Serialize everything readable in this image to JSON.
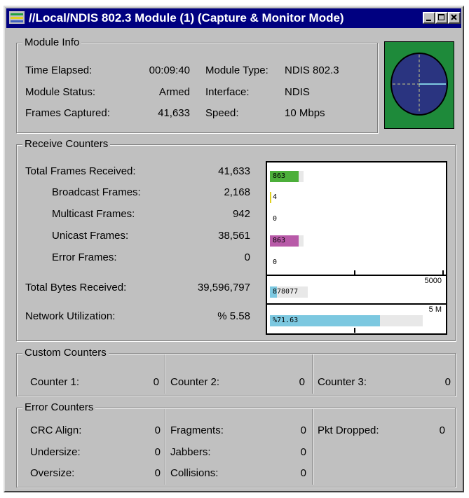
{
  "window": {
    "title": "//Local/NDIS 802.3 Module (1) (Capture & Monitor Mode)"
  },
  "module_info": {
    "label": "Module Info",
    "rows": [
      {
        "label": "Time Elapsed:",
        "value": "00:09:40",
        "label2": "Module Type:",
        "value2": "NDIS 802.3"
      },
      {
        "label": "Module Status:",
        "value": "Armed",
        "label2": "Interface:",
        "value2": "NDIS"
      },
      {
        "label": "Frames Captured:",
        "value": "41,633",
        "label2": "Speed:",
        "value2": "10 Mbps"
      }
    ]
  },
  "receive_counters": {
    "label": "Receive Counters",
    "rows": [
      {
        "label": "Total Frames Received:",
        "value": "41,633",
        "bar_label": "863",
        "bar_color": "#4caf3a",
        "fill_fraction": 0.86
      },
      {
        "label": "Broadcast Frames:",
        "value": "2,168",
        "bar_label": "4",
        "bar_color": "#e0d020",
        "fill_fraction": 0.04
      },
      {
        "label": "Multicast Frames:",
        "value": "942",
        "bar_label": "0",
        "bar_color": "#4caf3a",
        "fill_fraction": 0
      },
      {
        "label": "Unicast Frames:",
        "value": "38,561",
        "bar_label": "863",
        "bar_color": "#b85aa8",
        "fill_fraction": 0.86
      },
      {
        "label": "Error Frames:",
        "value": "0",
        "bar_label": "0",
        "bar_color": "#4caf3a",
        "fill_fraction": 0
      }
    ],
    "frames_scale": "5000",
    "bytes": {
      "label": "Total Bytes Received:",
      "value": "39,596,797",
      "bar_label": "878077",
      "bar_color": "#7cc8e0",
      "fill_fraction": 0.18
    },
    "bytes_scale": "5 M",
    "util": {
      "label": "Network Utilization:",
      "value": "% 5.58",
      "bar_label": "%71.63",
      "bar_color": "#7cc8e0",
      "fill_fraction": 0.72
    }
  },
  "custom_counters": {
    "label": "Custom Counters",
    "items": [
      {
        "label": "Counter 1:",
        "value": "0"
      },
      {
        "label": "Counter 2:",
        "value": "0"
      },
      {
        "label": "Counter 3:",
        "value": "0"
      }
    ]
  },
  "error_counters": {
    "label": "Error Counters",
    "col1": [
      {
        "label": "CRC Align:",
        "value": "0"
      },
      {
        "label": "Undersize:",
        "value": "0"
      },
      {
        "label": "Oversize:",
        "value": "0"
      }
    ],
    "col2": [
      {
        "label": "Fragments:",
        "value": "0"
      },
      {
        "label": "Jabbers:",
        "value": "0"
      },
      {
        "label": "Collisions:",
        "value": "0"
      }
    ],
    "col3": [
      {
        "label": "Pkt Dropped:",
        "value": "0"
      }
    ]
  },
  "colors": {
    "titlebar": "#000080",
    "radar_bg": "#1e8a3a",
    "radar_disc": "#2a3480"
  }
}
